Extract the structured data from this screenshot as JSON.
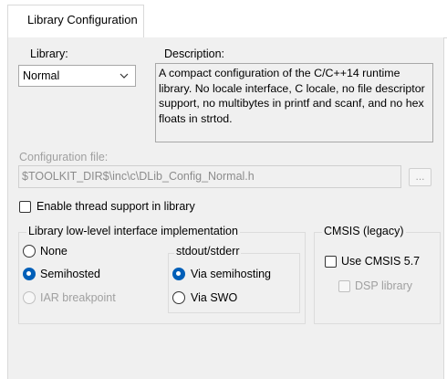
{
  "tab": {
    "label": "Library Configuration"
  },
  "library": {
    "label": "Library:",
    "selected": "Normal",
    "chevron_icon": "chevron-down-icon"
  },
  "description": {
    "label": "Description:",
    "text": "A compact configuration of the C/C++14 runtime library. No locale interface, C locale, no file descriptor support, no multibytes in printf and scanf, and no hex floats in strtod."
  },
  "config_file": {
    "label": "Configuration file:",
    "value": "$TOOLKIT_DIR$\\inc\\c\\DLib_Config_Normal.h",
    "browse_label": "..."
  },
  "thread_support": {
    "label": "Enable thread support in library",
    "checked": false
  },
  "low_level": {
    "title": "Library low-level interface implementation",
    "options": [
      {
        "label": "None",
        "selected": false,
        "enabled": true
      },
      {
        "label": "Semihosted",
        "selected": true,
        "enabled": true
      },
      {
        "label": "IAR breakpoint",
        "selected": false,
        "enabled": false
      }
    ],
    "stdout": {
      "title": "stdout/stderr",
      "options": [
        {
          "label": "Via semihosting",
          "selected": true
        },
        {
          "label": "Via SWO",
          "selected": false
        }
      ]
    }
  },
  "cmsis": {
    "title": "CMSIS (legacy)",
    "use_label": "Use CMSIS 5.7",
    "dsp_label": "DSP library"
  },
  "colors": {
    "accent": "#005fb8",
    "panel": "#f0f0f0",
    "disabled_text": "#a0a0a0"
  }
}
